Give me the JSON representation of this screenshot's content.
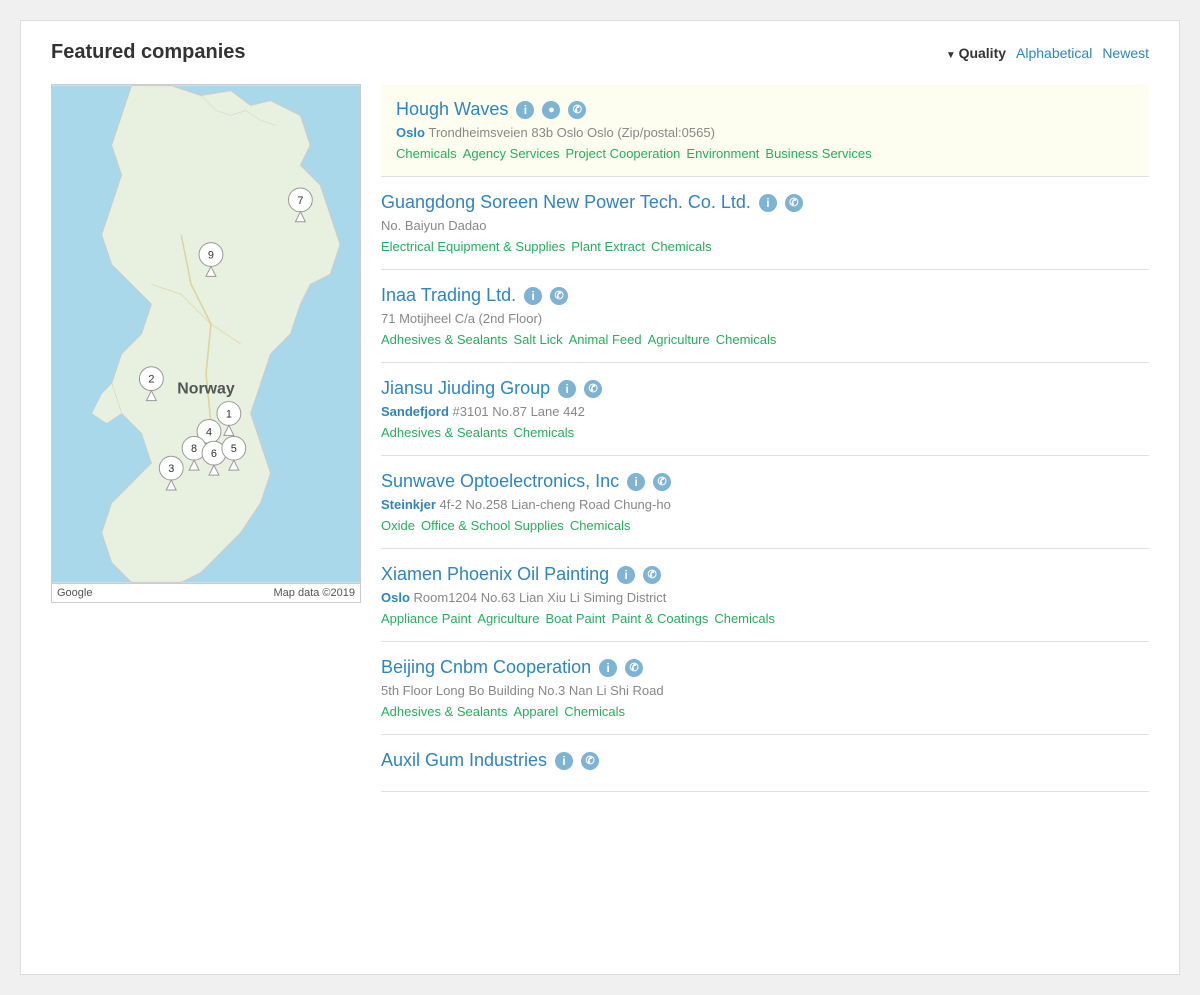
{
  "header": {
    "title": "Featured companies",
    "sort": {
      "active": "Quality",
      "options": [
        "Alphabetical",
        "Newest"
      ]
    }
  },
  "map": {
    "google_label": "Google",
    "map_data": "Map data ©2019"
  },
  "featured_companies": [
    {
      "name": "Hough Waves",
      "has_info": true,
      "has_globe": true,
      "has_phone": true,
      "city": "Oslo",
      "address": "Trondheimsveien 83b Oslo Oslo (Zip/postal:0565)",
      "tags": [
        "Chemicals",
        "Agency Services",
        "Project Cooperation",
        "Environment",
        "Business Services"
      ],
      "highlighted": true
    },
    {
      "name": "Guangdong Soreen New Power Tech. Co. Ltd.",
      "has_info": true,
      "has_globe": false,
      "has_phone": true,
      "city": "",
      "address": "No. Baiyun Dadao",
      "tags": [
        "Electrical Equipment & Supplies",
        "Plant Extract",
        "Chemicals"
      ],
      "highlighted": false
    },
    {
      "name": "Inaa Trading Ltd.",
      "has_info": true,
      "has_globe": false,
      "has_phone": true,
      "city": "",
      "address": "71 Motijheel C/a (2nd Floor)",
      "tags": [
        "Adhesives & Sealants",
        "Salt Lick",
        "Animal Feed",
        "Agriculture",
        "Chemicals"
      ],
      "highlighted": false
    },
    {
      "name": "Jiansu Jiuding Group",
      "has_info": true,
      "has_globe": false,
      "has_phone": true,
      "city": "Sandefjord",
      "address": "#3101 No.87 Lane 442",
      "tags": [
        "Adhesives & Sealants",
        "Chemicals"
      ],
      "highlighted": false
    },
    {
      "name": "Sunwave Optoelectronics, Inc",
      "has_info": true,
      "has_globe": false,
      "has_phone": true,
      "city": "Steinkjer",
      "address": "4f-2 No.258 Lian-cheng Road Chung-ho",
      "tags": [
        "Oxide",
        "Office & School Supplies",
        "Chemicals"
      ],
      "highlighted": false
    }
  ],
  "standalone_companies": [
    {
      "name": "Xiamen Phoenix Oil Painting",
      "has_info": true,
      "has_globe": false,
      "has_phone": true,
      "city": "Oslo",
      "address": "Room1204 No.63 Lian Xiu Li Siming District",
      "tags": [
        "Appliance Paint",
        "Agriculture",
        "Boat Paint",
        "Paint & Coatings",
        "Chemicals"
      ]
    },
    {
      "name": "Beijing Cnbm Cooperation",
      "has_info": true,
      "has_globe": false,
      "has_phone": true,
      "city": "",
      "address": "5th Floor Long Bo Building No.3 Nan Li Shi Road",
      "tags": [
        "Adhesives & Sealants",
        "Apparel",
        "Chemicals"
      ]
    },
    {
      "name": "Auxil Gum Industries",
      "has_info": true,
      "has_globe": false,
      "has_phone": true,
      "city": "",
      "address": "",
      "tags": []
    }
  ],
  "icons": {
    "info": "i",
    "globe": "🌐",
    "phone": "📞"
  }
}
